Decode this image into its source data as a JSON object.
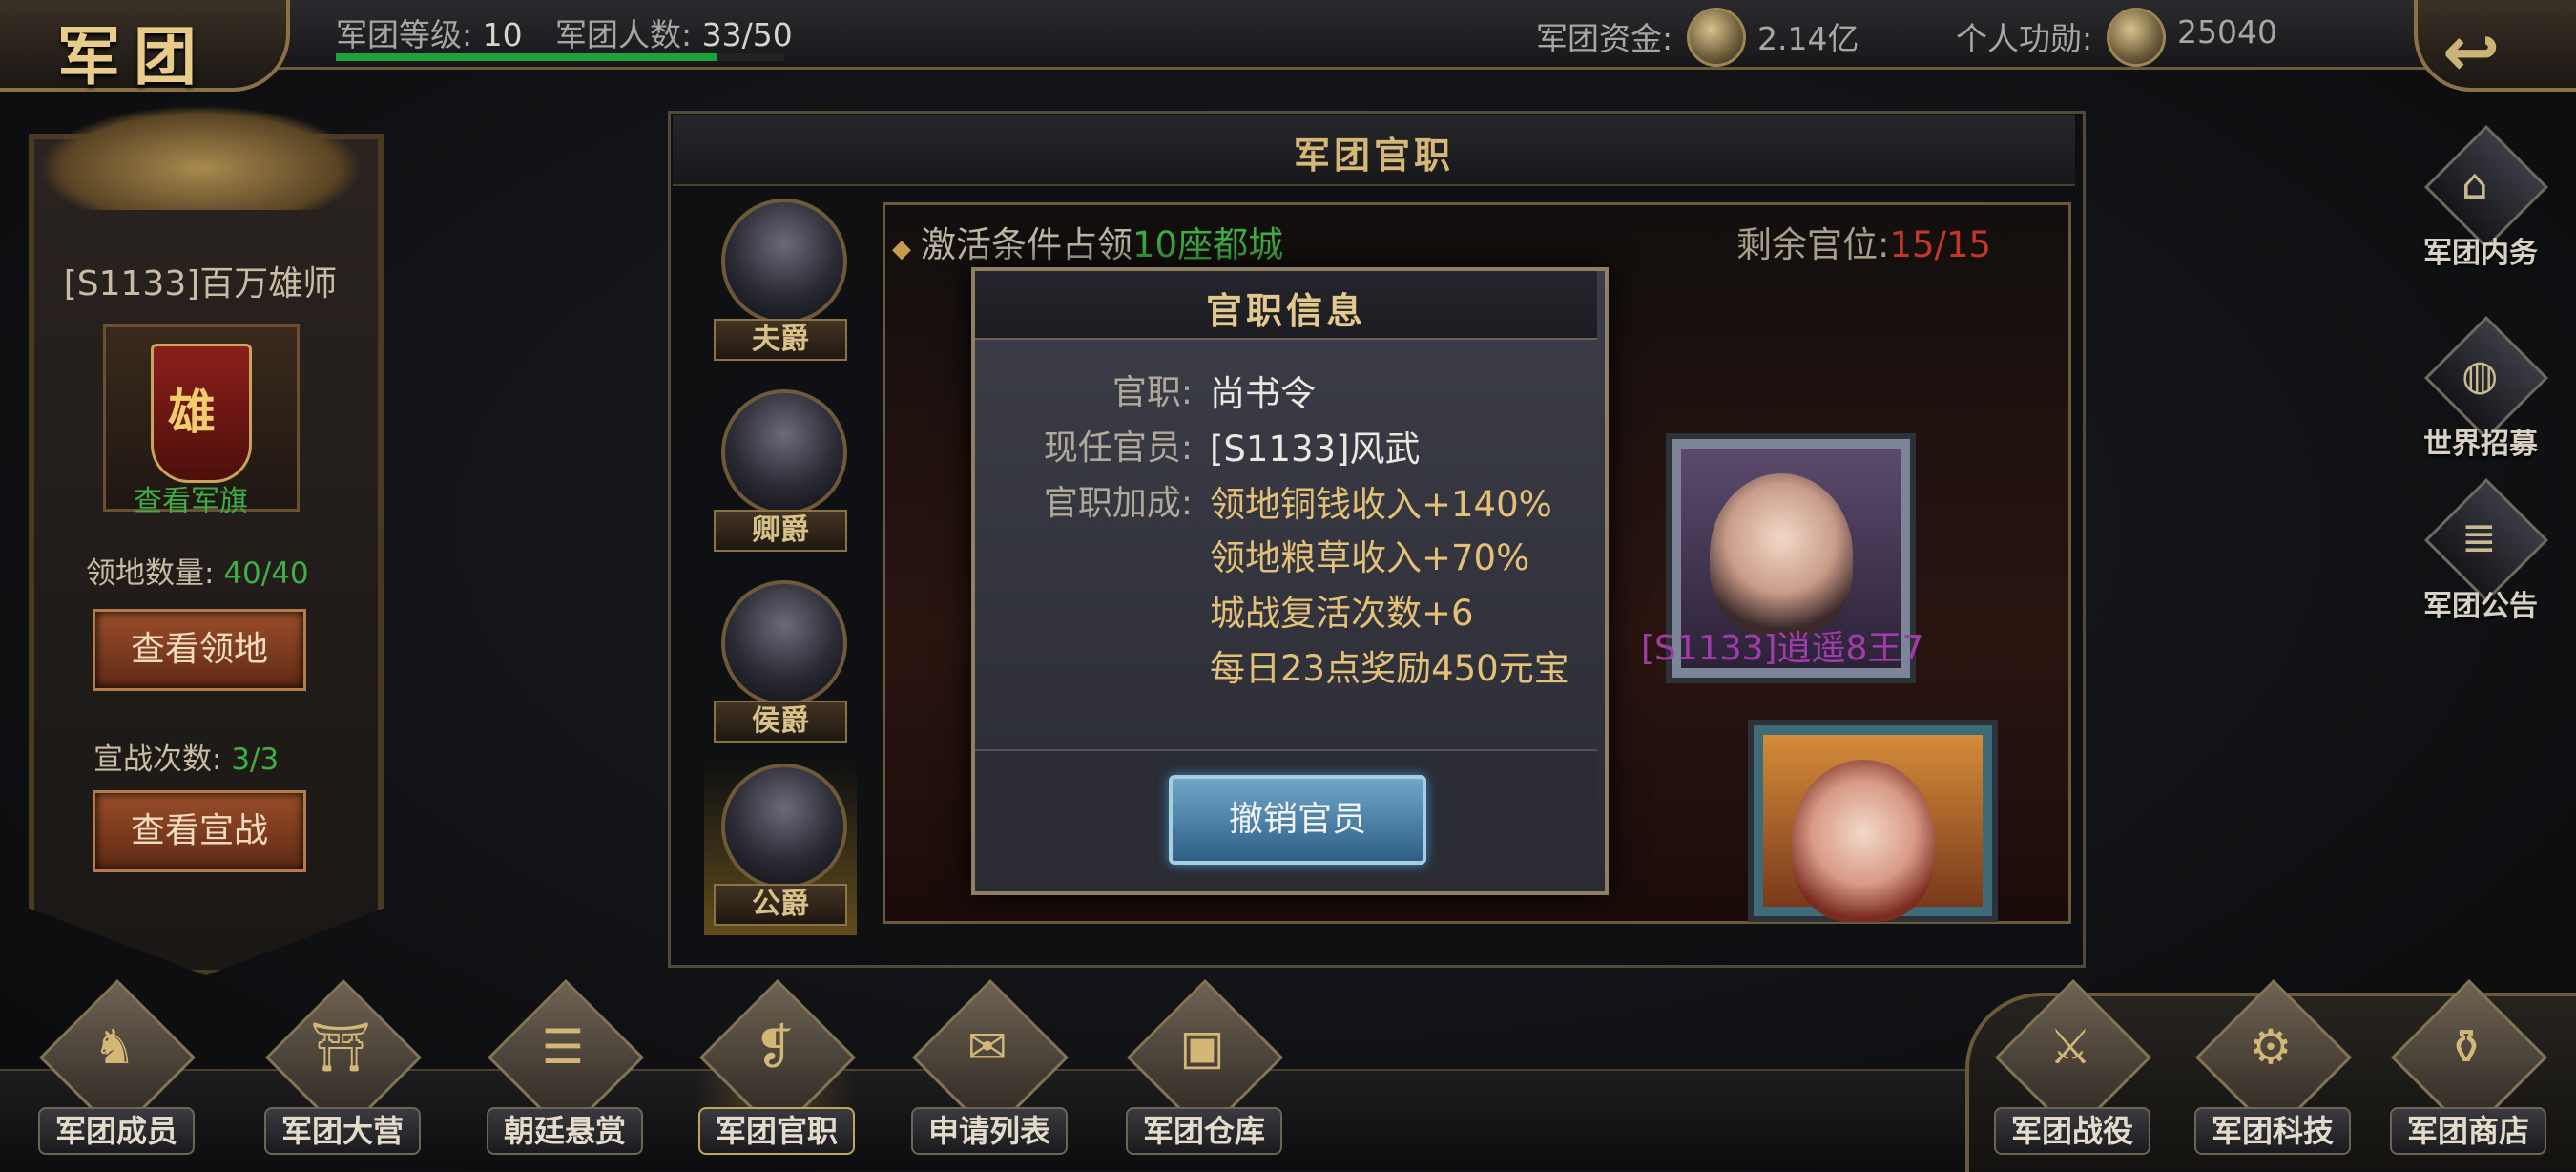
{
  "header": {
    "title": "军团",
    "level_label": "军团等级:",
    "level_value": "10",
    "members_label": "军团人数:",
    "members_value": "33/50",
    "funds_label": "军团资金:",
    "funds_value": "2.14亿",
    "merit_label": "个人功勋:",
    "merit_value": "25040",
    "back_icon": "back-arrow-icon"
  },
  "sidebar": {
    "guild_name": "[S1133]百万雄师",
    "flag_char": "雄",
    "view_flag": "查看军旗",
    "territory_label": "领地数量:",
    "territory_value": "40/40",
    "view_territory": "查看领地",
    "war_label": "宣战次数:",
    "war_value": "3/3",
    "view_war": "查看宣战"
  },
  "panel": {
    "title": "军团官职",
    "condition_prefix": "激活条件占领",
    "condition_value": "10座都城",
    "slots_label": "剩余官位:",
    "slots_value": "15/15",
    "holder_name": "[S1133]逍遥8王7",
    "ranks": [
      {
        "label": "夫爵"
      },
      {
        "label": "卿爵"
      },
      {
        "label": "侯爵"
      },
      {
        "label": "公爵"
      }
    ],
    "selected_rank": "公爵"
  },
  "modal": {
    "title": "官职信息",
    "post_label": "官职:",
    "post_value": "尚书令",
    "holder_label": "现任官员:",
    "holder_value": "[S1133]风武",
    "bonus_label": "官职加成:",
    "bonuses": [
      "领地铜钱收入+140%",
      "领地粮草收入+70%",
      "城战复活次数+6",
      "每日23点奖励450元宝"
    ],
    "revoke_button": "撤销官员"
  },
  "right_menu": [
    {
      "label": "军团内务",
      "icon": "palace-icon"
    },
    {
      "label": "世界招募",
      "icon": "globe-icon"
    },
    {
      "label": "军团公告",
      "icon": "notice-icon"
    }
  ],
  "bottom_menu": [
    {
      "label": "军团成员",
      "icon": "members-icon"
    },
    {
      "label": "军团大营",
      "icon": "camp-icon"
    },
    {
      "label": "朝廷悬赏",
      "icon": "bounty-icon"
    },
    {
      "label": "军团官职",
      "icon": "scroll-icon"
    },
    {
      "label": "申请列表",
      "icon": "application-icon"
    },
    {
      "label": "军团仓库",
      "icon": "chest-icon"
    },
    {
      "label": "军团战役",
      "icon": "battle-icon"
    },
    {
      "label": "军团科技",
      "icon": "tech-icon"
    },
    {
      "label": "军团商店",
      "icon": "shop-icon"
    }
  ],
  "colors": {
    "accent_gold": "#e4c98e",
    "green_value": "#3fae44",
    "red_value": "#c2372c",
    "purple_name": "#a03ca8"
  }
}
